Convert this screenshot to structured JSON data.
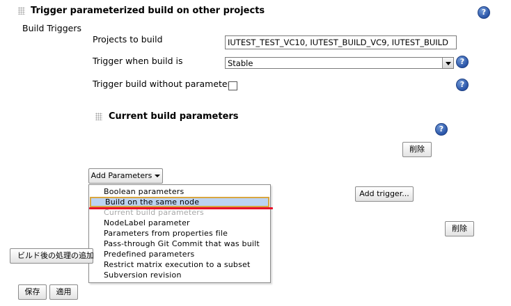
{
  "section": {
    "title": "Trigger parameterized build on other projects",
    "build_triggers_label": "Build Triggers"
  },
  "form": {
    "projects_label": "Projects to build",
    "projects_value": "IUTEST_TEST_VC10, IUTEST_BUILD_VC9, IUTEST_BUILD",
    "trigger_when_label": "Trigger when build is",
    "trigger_when_value": "Stable",
    "without_params_label": "Trigger build without parameters"
  },
  "current_params": {
    "title": "Current build parameters",
    "delete_label": "削除"
  },
  "add_params": {
    "label": "Add Parameters",
    "menu": [
      "Boolean parameters",
      "Build on the same node",
      "Current build parameters",
      "NodeLabel parameter",
      "Parameters from properties file",
      "Pass-through Git Commit that was built",
      "Predefined parameters",
      "Restrict matrix execution to a subset",
      "Subversion revision"
    ]
  },
  "add_trigger_label": "Add trigger...",
  "delete2_label": "削除",
  "post_build_label": "ビルド後の処理の追加",
  "footer": {
    "save_label": "保存",
    "apply_label": "適用"
  },
  "help_glyph": "?",
  "colors": {
    "highlight_bg": "#bcd3f2",
    "highlight_border": "#d9a640",
    "annotation_red": "#e8102a",
    "help_blue": "#2a55a8"
  }
}
